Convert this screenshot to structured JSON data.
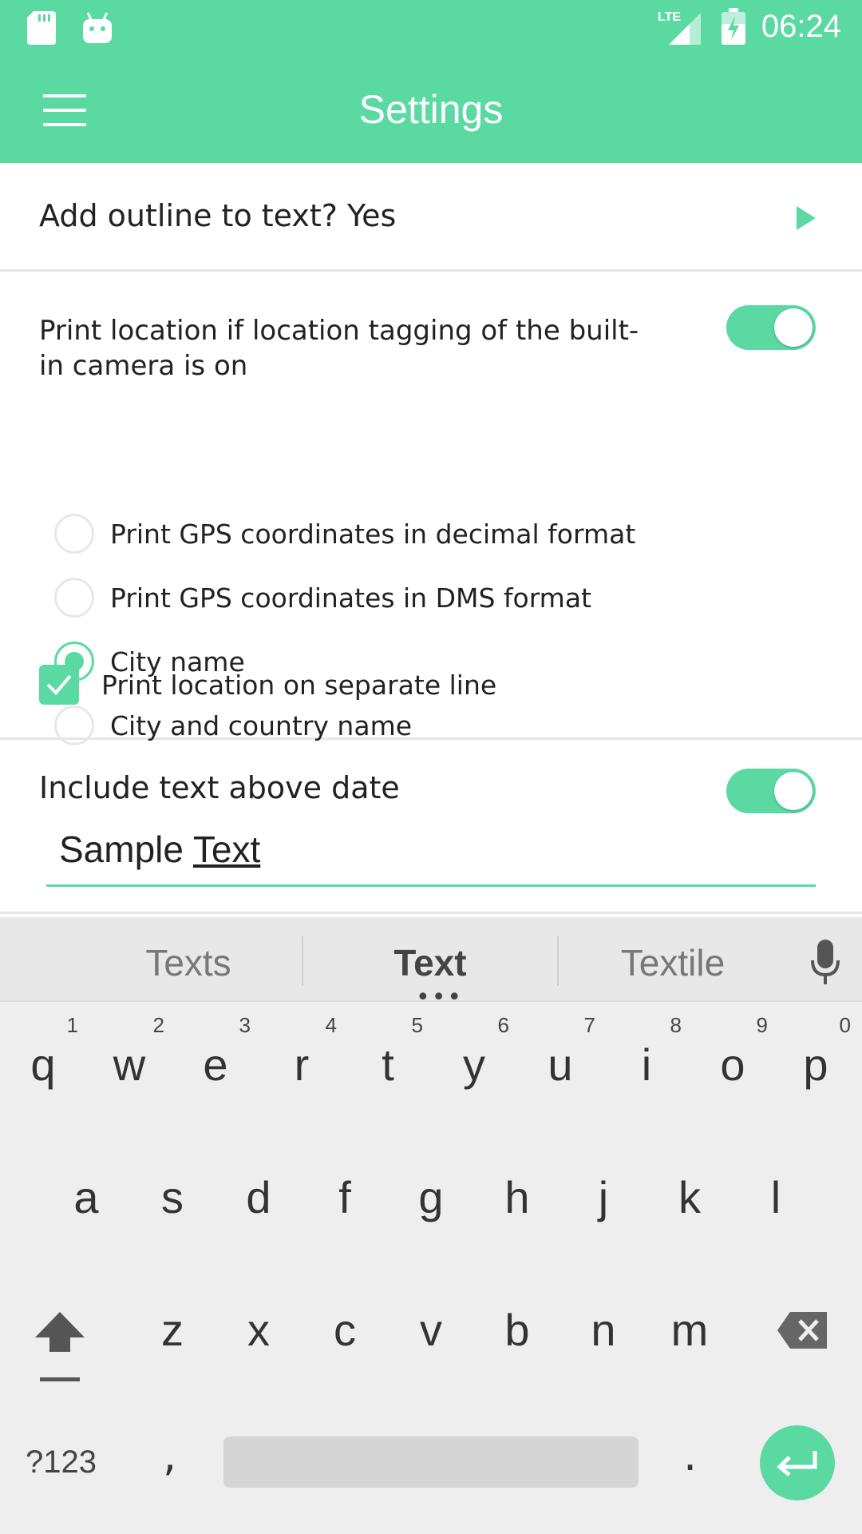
{
  "status_bar": {
    "time": "06:24",
    "network": "LTE",
    "icons": [
      "sd-card-icon",
      "android-icon",
      "lte-signal-icon",
      "battery-charging-icon"
    ]
  },
  "app_bar": {
    "title": "Settings",
    "menu_icon": "hamburger-menu-icon"
  },
  "settings": {
    "outline": {
      "label": "Add outline to text? Yes"
    },
    "location": {
      "title": "Print location if location tagging of the built-in camera is on",
      "enabled": true,
      "options": [
        {
          "label": "Print GPS coordinates in decimal format",
          "selected": false
        },
        {
          "label": "Print GPS coordinates in DMS format",
          "selected": false
        },
        {
          "label": "City name",
          "selected": true
        },
        {
          "label": "City and country name",
          "selected": false
        }
      ],
      "separate_line": {
        "label": "Print location on separate line",
        "checked": true
      }
    },
    "text_above_date": {
      "title": "Include text above date",
      "enabled": true,
      "value_prefix": "Sample ",
      "value_underlined": "Text"
    }
  },
  "keyboard": {
    "suggestions": [
      "Texts",
      "Text",
      "Textile"
    ],
    "row1": [
      {
        "key": "q",
        "num": "1"
      },
      {
        "key": "w",
        "num": "2"
      },
      {
        "key": "e",
        "num": "3"
      },
      {
        "key": "r",
        "num": "4"
      },
      {
        "key": "t",
        "num": "5"
      },
      {
        "key": "y",
        "num": "6"
      },
      {
        "key": "u",
        "num": "7"
      },
      {
        "key": "i",
        "num": "8"
      },
      {
        "key": "o",
        "num": "9"
      },
      {
        "key": "p",
        "num": "0"
      }
    ],
    "row2": [
      "a",
      "s",
      "d",
      "f",
      "g",
      "h",
      "j",
      "k",
      "l"
    ],
    "row3": [
      "z",
      "x",
      "c",
      "v",
      "b",
      "n",
      "m"
    ],
    "symbols_label": "?123",
    "comma": ",",
    "period": "."
  },
  "colors": {
    "accent": "#5bd9a3",
    "keyboard_bg": "#eeeeee"
  }
}
